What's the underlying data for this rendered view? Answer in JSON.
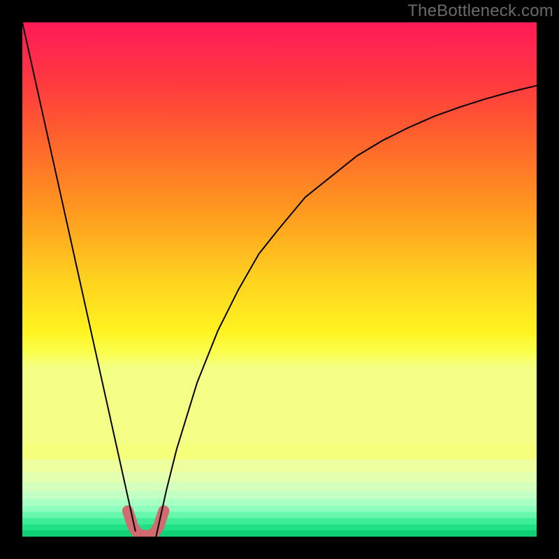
{
  "watermark": "TheBottleneck.com",
  "chart_data": {
    "type": "line",
    "title": "",
    "xlabel": "",
    "ylabel": "",
    "xlim": [
      0,
      100
    ],
    "ylim": [
      0,
      100
    ],
    "series": [
      {
        "name": "curve-left",
        "x": [
          0,
          2,
          4,
          6,
          8,
          10,
          12,
          14,
          16,
          18,
          20,
          21,
          22
        ],
        "y": [
          100,
          91,
          82,
          73,
          64,
          55,
          46,
          37,
          28,
          19,
          10,
          5.5,
          1
        ]
      },
      {
        "name": "curve-right",
        "x": [
          26,
          28,
          30,
          34,
          38,
          42,
          46,
          50,
          55,
          60,
          65,
          70,
          75,
          80,
          85,
          90,
          95,
          100
        ],
        "y": [
          0,
          9,
          17,
          30,
          40,
          48,
          55,
          60,
          66,
          70,
          74,
          77,
          79.5,
          81.7,
          83.5,
          85.1,
          86.5,
          87.7
        ]
      },
      {
        "name": "dip-highlight",
        "x": [
          20.5,
          21.5,
          22.5,
          23.5,
          24.5,
          25.5,
          26.5,
          27.5
        ],
        "y": [
          5,
          2,
          0.5,
          0.2,
          0.2,
          0.5,
          2,
          5
        ]
      }
    ],
    "gradient_stops": [
      {
        "offset": 0.0,
        "color": "#ff1a58"
      },
      {
        "offset": 0.15,
        "color": "#ff3b3e"
      },
      {
        "offset": 0.3,
        "color": "#ff6a2a"
      },
      {
        "offset": 0.45,
        "color": "#ff9a1f"
      },
      {
        "offset": 0.6,
        "color": "#ffcf1f"
      },
      {
        "offset": 0.73,
        "color": "#fff21f"
      },
      {
        "offset": 0.78,
        "color": "#fbff4a"
      },
      {
        "offset": 0.82,
        "color": "#f4ff86"
      }
    ],
    "bottom_bands": [
      {
        "y0": 0.82,
        "y1": 0.85,
        "color": "#f6ff7a"
      },
      {
        "y0": 0.85,
        "y1": 0.875,
        "color": "#eeffa0"
      },
      {
        "y0": 0.875,
        "y1": 0.895,
        "color": "#e3ffb0"
      },
      {
        "y0": 0.895,
        "y1": 0.912,
        "color": "#d4ffbc"
      },
      {
        "y0": 0.912,
        "y1": 0.927,
        "color": "#c2ffc2"
      },
      {
        "y0": 0.927,
        "y1": 0.94,
        "color": "#a8ffc2"
      },
      {
        "y0": 0.94,
        "y1": 0.952,
        "color": "#8cffbe"
      },
      {
        "y0": 0.952,
        "y1": 0.964,
        "color": "#66f7ad"
      },
      {
        "y0": 0.964,
        "y1": 0.976,
        "color": "#3eec98"
      },
      {
        "y0": 0.976,
        "y1": 0.988,
        "color": "#1fe085"
      },
      {
        "y0": 0.988,
        "y1": 1.0,
        "color": "#0fd075"
      }
    ]
  }
}
